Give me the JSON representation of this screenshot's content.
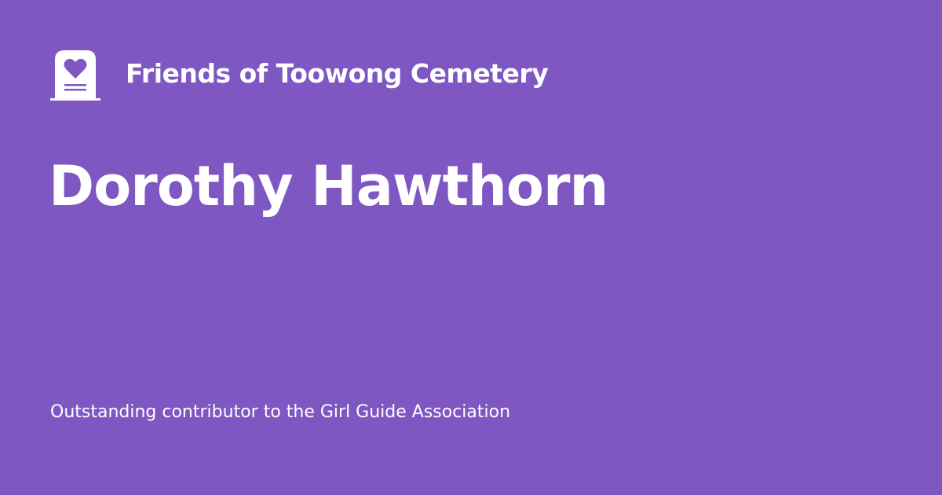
{
  "brand": {
    "name": "Friends of Toowong Cemetery",
    "icon": "tombstone-heart-icon"
  },
  "page": {
    "title": "Dorothy Hawthorn",
    "description": "Outstanding contributor to the Girl Guide Association"
  },
  "colors": {
    "background": "#7e57c2",
    "foreground": "#ffffff"
  }
}
